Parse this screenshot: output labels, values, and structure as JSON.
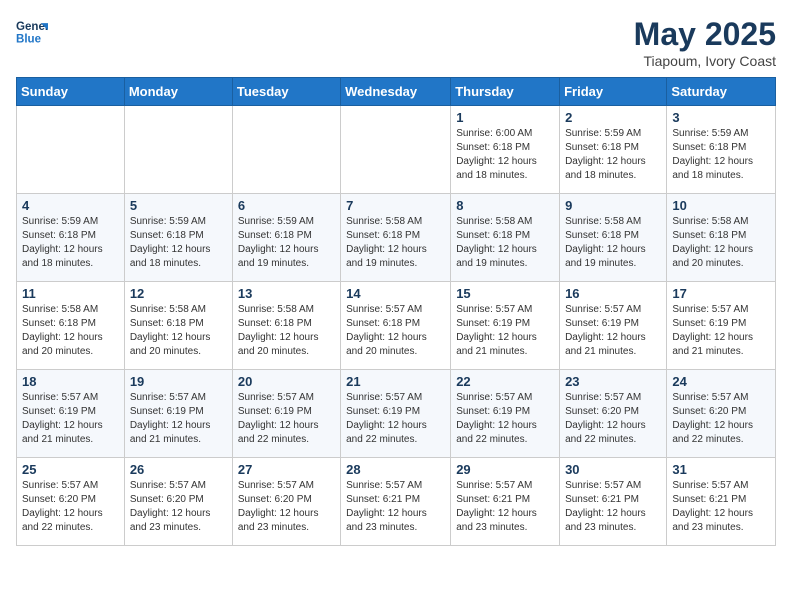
{
  "logo": {
    "line1": "General",
    "line2": "Blue"
  },
  "title": "May 2025",
  "subtitle": "Tiapoum, Ivory Coast",
  "weekdays": [
    "Sunday",
    "Monday",
    "Tuesday",
    "Wednesday",
    "Thursday",
    "Friday",
    "Saturday"
  ],
  "weeks": [
    [
      {
        "day": "",
        "info": ""
      },
      {
        "day": "",
        "info": ""
      },
      {
        "day": "",
        "info": ""
      },
      {
        "day": "",
        "info": ""
      },
      {
        "day": "1",
        "info": "Sunrise: 6:00 AM\nSunset: 6:18 PM\nDaylight: 12 hours\nand 18 minutes."
      },
      {
        "day": "2",
        "info": "Sunrise: 5:59 AM\nSunset: 6:18 PM\nDaylight: 12 hours\nand 18 minutes."
      },
      {
        "day": "3",
        "info": "Sunrise: 5:59 AM\nSunset: 6:18 PM\nDaylight: 12 hours\nand 18 minutes."
      }
    ],
    [
      {
        "day": "4",
        "info": "Sunrise: 5:59 AM\nSunset: 6:18 PM\nDaylight: 12 hours\nand 18 minutes."
      },
      {
        "day": "5",
        "info": "Sunrise: 5:59 AM\nSunset: 6:18 PM\nDaylight: 12 hours\nand 18 minutes."
      },
      {
        "day": "6",
        "info": "Sunrise: 5:59 AM\nSunset: 6:18 PM\nDaylight: 12 hours\nand 19 minutes."
      },
      {
        "day": "7",
        "info": "Sunrise: 5:58 AM\nSunset: 6:18 PM\nDaylight: 12 hours\nand 19 minutes."
      },
      {
        "day": "8",
        "info": "Sunrise: 5:58 AM\nSunset: 6:18 PM\nDaylight: 12 hours\nand 19 minutes."
      },
      {
        "day": "9",
        "info": "Sunrise: 5:58 AM\nSunset: 6:18 PM\nDaylight: 12 hours\nand 19 minutes."
      },
      {
        "day": "10",
        "info": "Sunrise: 5:58 AM\nSunset: 6:18 PM\nDaylight: 12 hours\nand 20 minutes."
      }
    ],
    [
      {
        "day": "11",
        "info": "Sunrise: 5:58 AM\nSunset: 6:18 PM\nDaylight: 12 hours\nand 20 minutes."
      },
      {
        "day": "12",
        "info": "Sunrise: 5:58 AM\nSunset: 6:18 PM\nDaylight: 12 hours\nand 20 minutes."
      },
      {
        "day": "13",
        "info": "Sunrise: 5:58 AM\nSunset: 6:18 PM\nDaylight: 12 hours\nand 20 minutes."
      },
      {
        "day": "14",
        "info": "Sunrise: 5:57 AM\nSunset: 6:18 PM\nDaylight: 12 hours\nand 20 minutes."
      },
      {
        "day": "15",
        "info": "Sunrise: 5:57 AM\nSunset: 6:19 PM\nDaylight: 12 hours\nand 21 minutes."
      },
      {
        "day": "16",
        "info": "Sunrise: 5:57 AM\nSunset: 6:19 PM\nDaylight: 12 hours\nand 21 minutes."
      },
      {
        "day": "17",
        "info": "Sunrise: 5:57 AM\nSunset: 6:19 PM\nDaylight: 12 hours\nand 21 minutes."
      }
    ],
    [
      {
        "day": "18",
        "info": "Sunrise: 5:57 AM\nSunset: 6:19 PM\nDaylight: 12 hours\nand 21 minutes."
      },
      {
        "day": "19",
        "info": "Sunrise: 5:57 AM\nSunset: 6:19 PM\nDaylight: 12 hours\nand 21 minutes."
      },
      {
        "day": "20",
        "info": "Sunrise: 5:57 AM\nSunset: 6:19 PM\nDaylight: 12 hours\nand 22 minutes."
      },
      {
        "day": "21",
        "info": "Sunrise: 5:57 AM\nSunset: 6:19 PM\nDaylight: 12 hours\nand 22 minutes."
      },
      {
        "day": "22",
        "info": "Sunrise: 5:57 AM\nSunset: 6:19 PM\nDaylight: 12 hours\nand 22 minutes."
      },
      {
        "day": "23",
        "info": "Sunrise: 5:57 AM\nSunset: 6:20 PM\nDaylight: 12 hours\nand 22 minutes."
      },
      {
        "day": "24",
        "info": "Sunrise: 5:57 AM\nSunset: 6:20 PM\nDaylight: 12 hours\nand 22 minutes."
      }
    ],
    [
      {
        "day": "25",
        "info": "Sunrise: 5:57 AM\nSunset: 6:20 PM\nDaylight: 12 hours\nand 22 minutes."
      },
      {
        "day": "26",
        "info": "Sunrise: 5:57 AM\nSunset: 6:20 PM\nDaylight: 12 hours\nand 23 minutes."
      },
      {
        "day": "27",
        "info": "Sunrise: 5:57 AM\nSunset: 6:20 PM\nDaylight: 12 hours\nand 23 minutes."
      },
      {
        "day": "28",
        "info": "Sunrise: 5:57 AM\nSunset: 6:21 PM\nDaylight: 12 hours\nand 23 minutes."
      },
      {
        "day": "29",
        "info": "Sunrise: 5:57 AM\nSunset: 6:21 PM\nDaylight: 12 hours\nand 23 minutes."
      },
      {
        "day": "30",
        "info": "Sunrise: 5:57 AM\nSunset: 6:21 PM\nDaylight: 12 hours\nand 23 minutes."
      },
      {
        "day": "31",
        "info": "Sunrise: 5:57 AM\nSunset: 6:21 PM\nDaylight: 12 hours\nand 23 minutes."
      }
    ]
  ]
}
